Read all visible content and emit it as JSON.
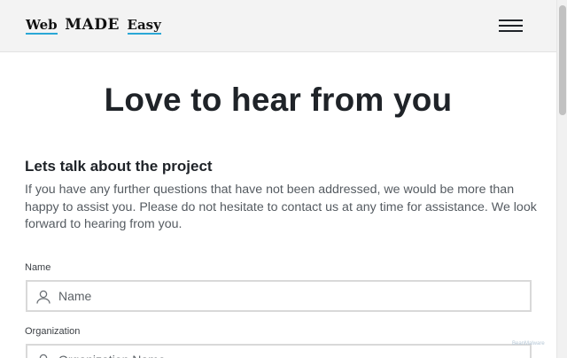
{
  "header": {
    "logo": {
      "part1": "Web",
      "part2": "MADE",
      "part3": "Easy"
    },
    "menu_icon": "hamburger-icon"
  },
  "main": {
    "title": "Love to hear from you",
    "subheading": "Lets talk about the project",
    "intro": "If you have any further questions that have not been addressed, we would be more than happy to assist you. Please do not hesitate to contact us at any time for assistance. We look forward to hearing from you."
  },
  "form": {
    "name": {
      "label": "Name",
      "placeholder": "Name",
      "value": "",
      "icon": "user-icon"
    },
    "organization": {
      "label": "Organization",
      "placeholder": "Organization Name",
      "value": "",
      "icon": "user-icon"
    }
  },
  "watermark": "BeanMalware",
  "colors": {
    "header_bg": "#f3f3f3",
    "logo_underline": "#2aa7d6",
    "text_primary": "#1f2328",
    "text_secondary": "#555b61",
    "field_border": "#d9d9d9"
  }
}
